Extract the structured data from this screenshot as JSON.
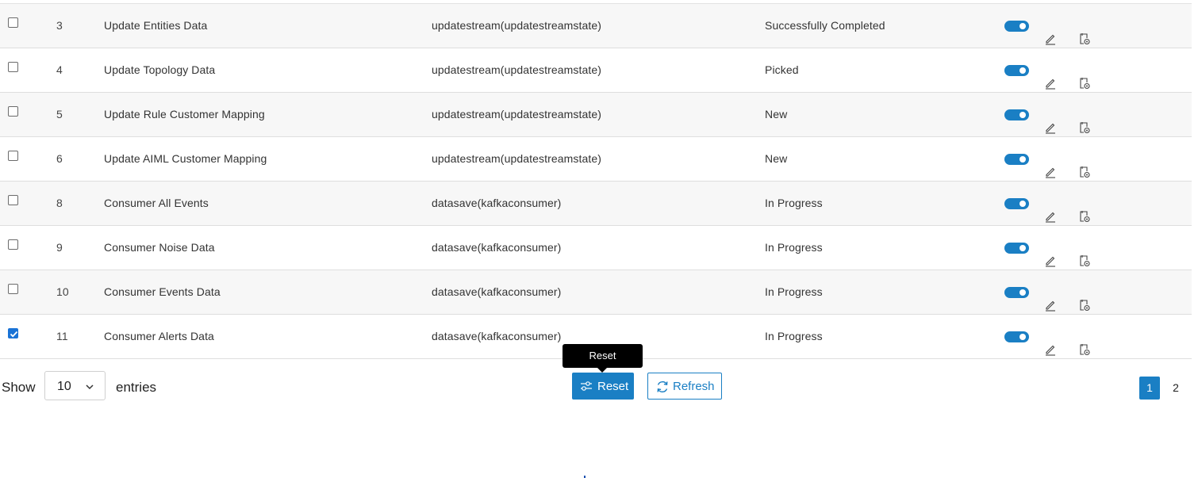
{
  "colors": {
    "accent": "#1a7fc4",
    "checked": "#1a73d6",
    "row_alt": "#f7f7f7"
  },
  "rows": [
    {
      "checked": false,
      "id": "3",
      "name": "Update Entities Data",
      "type": "updatestream(updatestreamstate)",
      "status": "Successfully Completed",
      "enabled": true
    },
    {
      "checked": false,
      "id": "4",
      "name": "Update Topology Data",
      "type": "updatestream(updatestreamstate)",
      "status": "Picked",
      "enabled": true
    },
    {
      "checked": false,
      "id": "5",
      "name": "Update Rule Customer Mapping",
      "type": "updatestream(updatestreamstate)",
      "status": "New",
      "enabled": true
    },
    {
      "checked": false,
      "id": "6",
      "name": "Update AIML Customer Mapping",
      "type": "updatestream(updatestreamstate)",
      "status": "New",
      "enabled": true
    },
    {
      "checked": false,
      "id": "8",
      "name": "Consumer All Events",
      "type": "datasave(kafkaconsumer)",
      "status": "In Progress",
      "enabled": true
    },
    {
      "checked": false,
      "id": "9",
      "name": "Consumer Noise Data",
      "type": "datasave(kafkaconsumer)",
      "status": "In Progress",
      "enabled": true
    },
    {
      "checked": false,
      "id": "10",
      "name": "Consumer Events Data",
      "type": "datasave(kafkaconsumer)",
      "status": "In Progress",
      "enabled": true
    },
    {
      "checked": true,
      "id": "11",
      "name": "Consumer Alerts Data",
      "type": "datasave(kafkaconsumer)",
      "status": "In Progress",
      "enabled": true
    }
  ],
  "row_icons": {
    "toggle": "toggle-switch-icon",
    "edit": "pencil-icon",
    "schedule": "schedule-settings-icon"
  },
  "footer": {
    "show_label": "Show",
    "entries_value": "10",
    "entries_label": "entries",
    "reset_label": "Reset",
    "refresh_label": "Refresh",
    "tooltip": "Reset",
    "pages": [
      "1",
      "2"
    ],
    "current_page": "1"
  }
}
